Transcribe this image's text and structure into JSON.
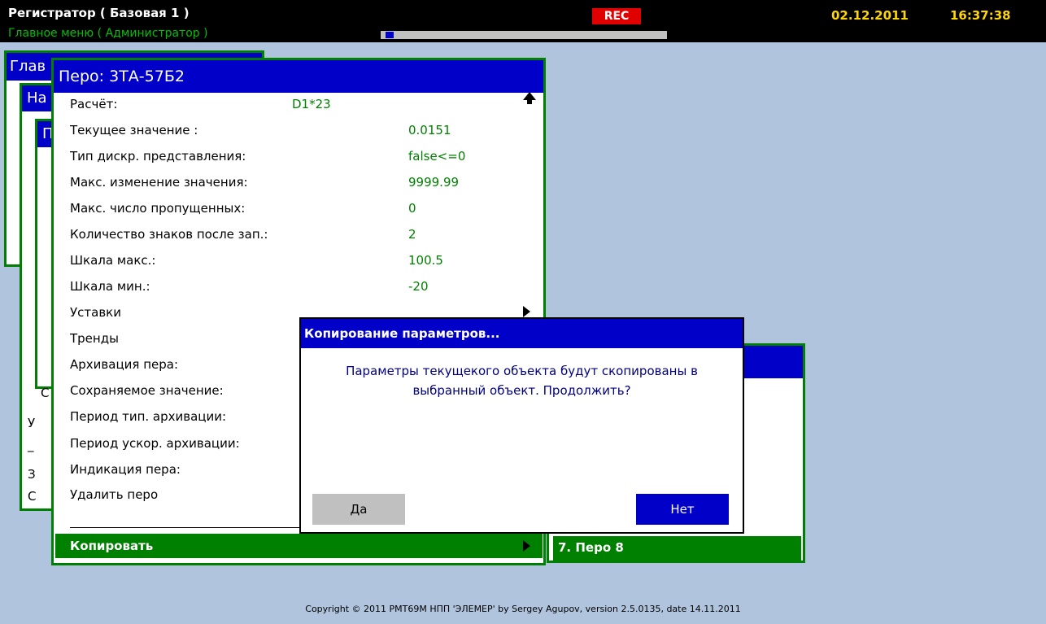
{
  "header": {
    "app_title": "Регистратор ( Базовая 1 )",
    "menu_path": "Главное меню ( Администратор )",
    "rec_label": "REC",
    "progress_fraction": 0.03,
    "date": "02.12.2011",
    "time": "16:37:38"
  },
  "background_windows": {
    "win1_title": "Глав",
    "win2_title": "На",
    "win3_title": "П",
    "side_chars": [
      "С",
      "У",
      "_",
      "З",
      "С"
    ]
  },
  "pen_window": {
    "title": "Перо: 3ТА-57Б2",
    "rows": [
      {
        "label": "Расчёт:",
        "value": "D1*23"
      },
      {
        "label": "Текущее значение :",
        "value": "0.0151"
      },
      {
        "label": "Тип дискр. представления:",
        "value": "false<=0"
      },
      {
        "label": "Макс. изменение значения:",
        "value": "9999.99"
      },
      {
        "label": "Макс. число пропущенных:",
        "value": "0"
      },
      {
        "label": "Количество знаков после зап.:",
        "value": "2"
      },
      {
        "label": "Шкала макс.:",
        "value": "100.5"
      },
      {
        "label": "Шкала мин.:",
        "value": "-20"
      },
      {
        "label": "Уставки",
        "value": ""
      },
      {
        "label": "Тренды",
        "value": ""
      },
      {
        "label": "Архивация пера:",
        "value": ""
      },
      {
        "label": "Сохраняемое значение:",
        "value": ""
      },
      {
        "label": "Период тип. архивации:",
        "value": ""
      },
      {
        "label": "Период ускор. архивации:",
        "value": ""
      },
      {
        "label": "Индикация пера:",
        "value": ""
      },
      {
        "label": "Удалить перо",
        "value": ""
      }
    ],
    "copy_label": "Копировать"
  },
  "submenu": {
    "selected_label": "7. Перо 8"
  },
  "dialog": {
    "title": "Копирование параметров...",
    "message_line1": "Параметры текущекого объекта будут скопированы в",
    "message_line2": "выбранный объект. Продолжить?",
    "yes_label": "Да",
    "no_label": "Нет"
  },
  "footer": {
    "copyright": "Copyright © 2011 РМТ69М НПП 'ЭЛЕМЕР' by Sergey Agupov, version 2.5.0135, date 14.11.2011"
  },
  "colors": {
    "background": "#b0c4de",
    "title_blue": "#0000c8",
    "frame_green": "#008000",
    "value_green": "#008000",
    "rec_red": "#e00000",
    "clock_yellow": "#ffd700"
  }
}
